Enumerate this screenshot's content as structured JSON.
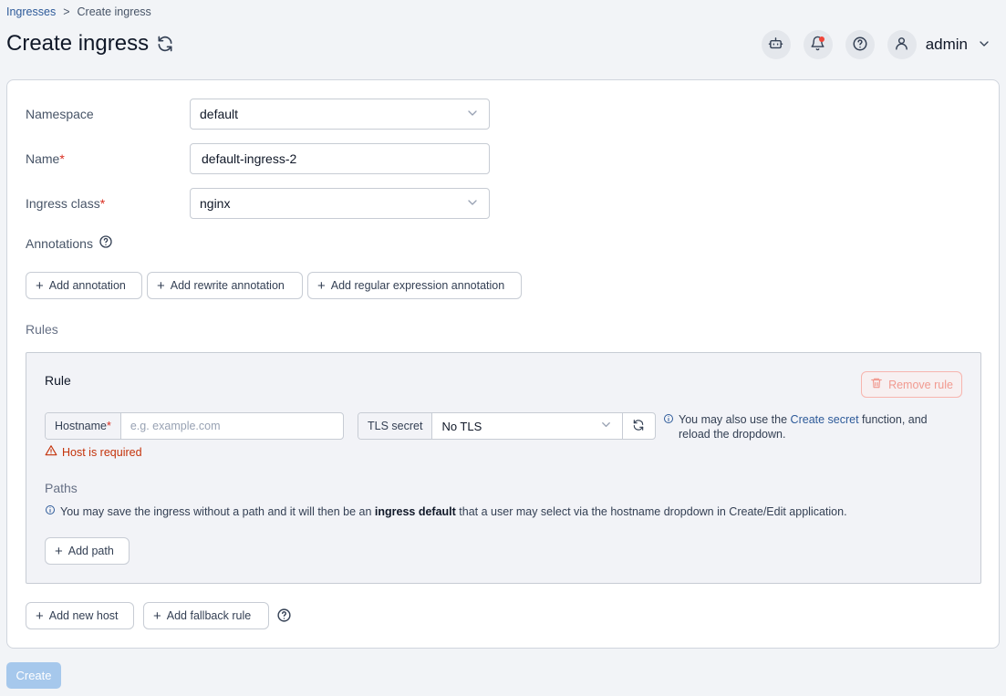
{
  "breadcrumb": {
    "parent": "Ingresses",
    "separator": ">",
    "current": "Create ingress"
  },
  "header": {
    "title": "Create ingress",
    "user": "admin"
  },
  "form": {
    "namespace": {
      "label": "Namespace",
      "value": "default"
    },
    "name": {
      "label": "Name",
      "required_mark": "*",
      "value": "default-ingress-2"
    },
    "ingress_class": {
      "label": "Ingress class",
      "required_mark": "*",
      "value": "nginx"
    },
    "annotations": {
      "label": "Annotations",
      "add_annotation": "Add annotation",
      "add_rewrite": "Add rewrite annotation",
      "add_regex": "Add regular expression annotation"
    },
    "rules_label": "Rules"
  },
  "rule": {
    "title": "Rule",
    "remove_label": "Remove rule",
    "hostname": {
      "label": "Hostname",
      "required_mark": "*",
      "placeholder": "e.g. example.com"
    },
    "host_error": "Host is required",
    "tls": {
      "label": "TLS secret",
      "value": "No TLS"
    },
    "tls_info": {
      "before": "You may also use the ",
      "link": "Create secret",
      "after": " function, and reload the dropdown."
    },
    "paths": {
      "label": "Paths",
      "info_before": "You may save the ingress without a path and it will then be an ",
      "info_bold": "ingress default",
      "info_after": " that a user may select via the hostname dropdown in Create/Edit application.",
      "add_path": "Add path"
    }
  },
  "footer_actions": {
    "add_host": "Add new host",
    "add_fallback": "Add fallback rule"
  },
  "submit": {
    "create_label": "Create"
  },
  "colors": {
    "primary_link": "#2d5a99",
    "error": "#c4320a",
    "required": "#d92d20",
    "create_disabled": "#a6c8ec"
  }
}
